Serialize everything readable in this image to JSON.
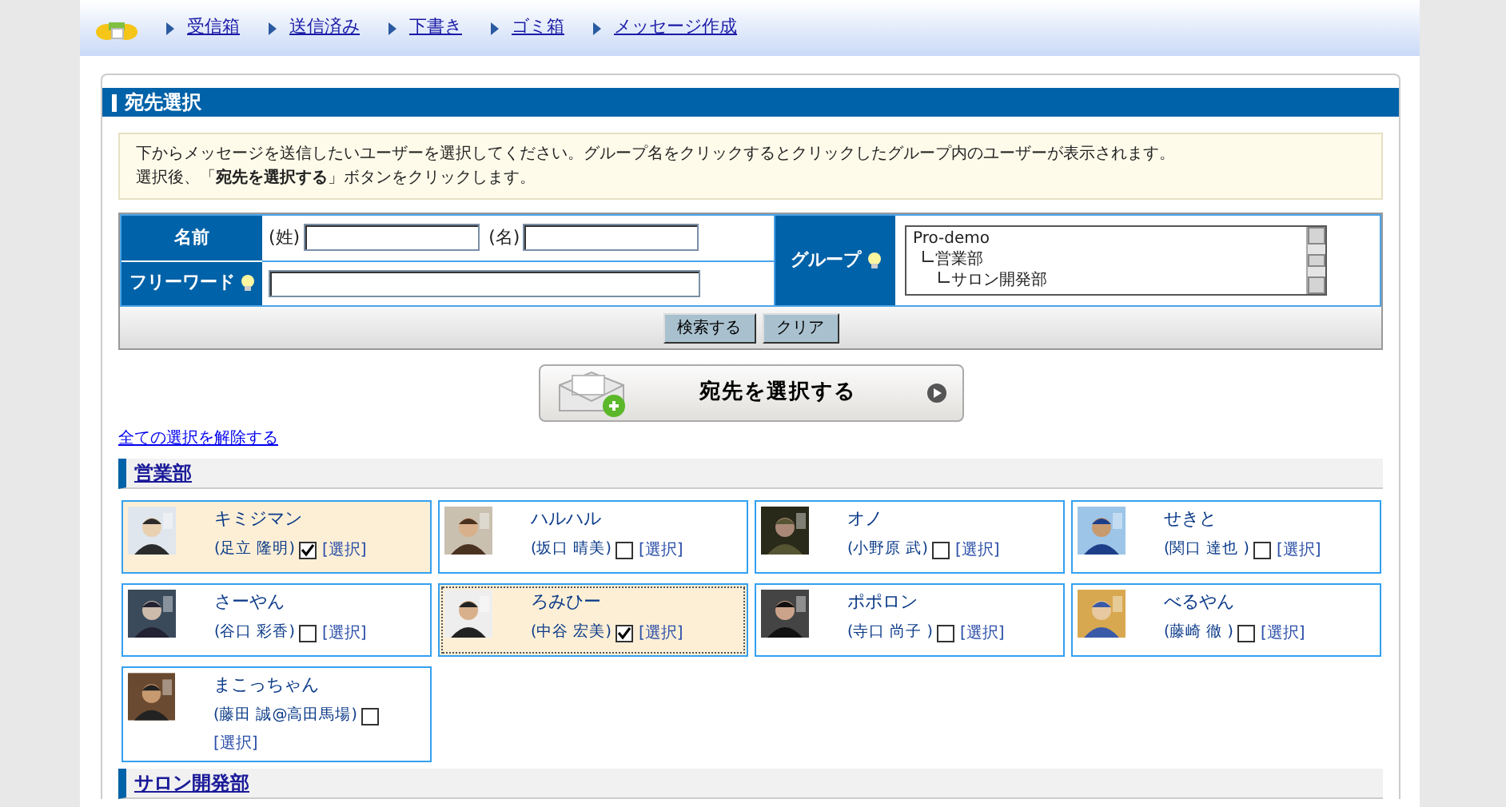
{
  "nav": {
    "items": [
      "受信箱",
      "送信済み",
      "下書き",
      "ゴミ箱",
      "メッセージ作成"
    ]
  },
  "panel": {
    "title": "宛先選択"
  },
  "instructions": [
    "下からメッセージを送信したいユーザーを選択してください。グループ名をクリックするとクリックしたグループ内のユーザーが表示されます。",
    "選択後、「**宛先を選択する**」ボタンをクリックします。"
  ],
  "search": {
    "name_label": "名前",
    "last_name_label": "(姓)",
    "first_name_label": "(名)",
    "freeword_label": "フリーワード",
    "group_label": "グループ",
    "groups": [
      {
        "label": "Pro-demo",
        "children": [
          {
            "label": "営業部",
            "children": [
              {
                "label": "サロン開発部"
              }
            ]
          }
        ]
      }
    ],
    "search_button": "検索する",
    "clear_button": "クリア"
  },
  "submit_button": "宛先を選択する",
  "clear_all_link": "全ての選択を解除する",
  "sections": [
    {
      "name": "営業部",
      "members": [
        {
          "name": "キミジマン",
          "full_name": "(足立 隆明)",
          "checked": true,
          "focused": false,
          "select_label": "[選択]"
        },
        {
          "name": "ハルハル",
          "full_name": "(坂口 晴美)",
          "checked": false,
          "focused": false,
          "select_label": "[選択]"
        },
        {
          "name": "オノ",
          "full_name": "(小野原 武)",
          "checked": false,
          "focused": false,
          "select_label": "[選択]"
        },
        {
          "name": "せきと",
          "full_name": "(関口 達也 )",
          "checked": false,
          "focused": false,
          "select_label": "[選択]"
        },
        {
          "name": "さーやん",
          "full_name": "(谷口 彩香)",
          "checked": false,
          "focused": false,
          "select_label": "[選択]"
        },
        {
          "name": "ろみひー",
          "full_name": "(中谷 宏美)",
          "checked": true,
          "focused": true,
          "select_label": "[選択]"
        },
        {
          "name": "ポポロン",
          "full_name": "(寺口 尚子 )",
          "checked": false,
          "focused": false,
          "select_label": "[選択]"
        },
        {
          "name": "べるやん",
          "full_name": "(藤崎 徹 )",
          "checked": false,
          "focused": false,
          "select_label": "[選択]"
        },
        {
          "name": "まこっちゃん",
          "full_name": "(藤田 誠@高田馬場)",
          "checked": false,
          "focused": false,
          "select_label": "[選択]"
        }
      ]
    },
    {
      "name": "サロン開発部"
    }
  ]
}
